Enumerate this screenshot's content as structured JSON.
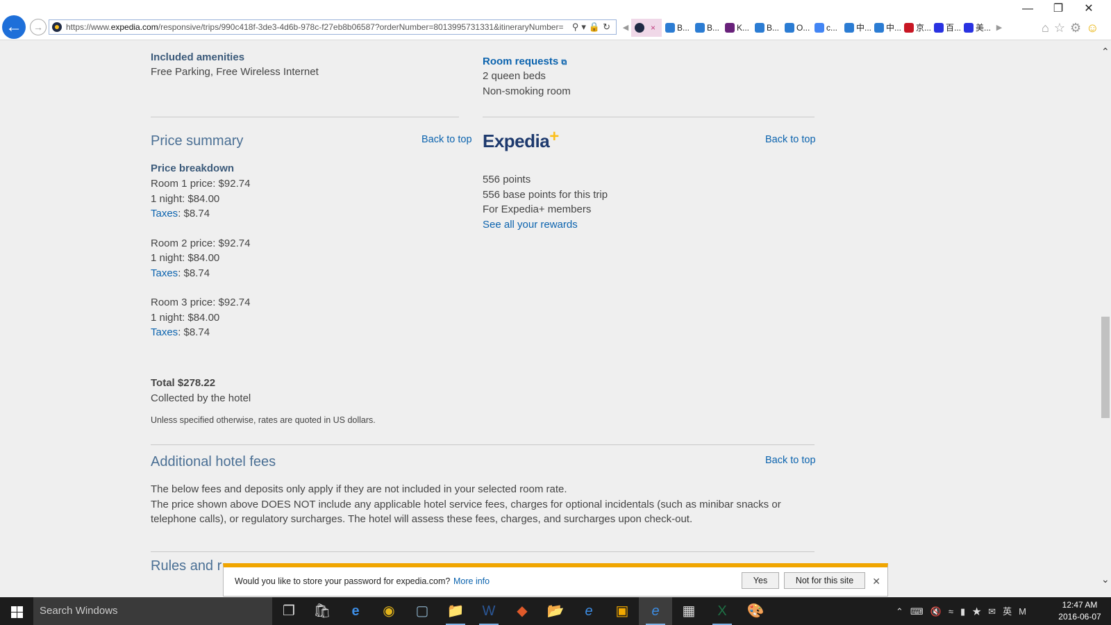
{
  "browser": {
    "url_prefix": "https://www.",
    "url_domain": "expedia.com",
    "url_rest": "/responsive/trips/990c418f-3de3-4d6b-978c-f27eb8b06587?orderNumber=8013995731331&itineraryNumber=",
    "tabs": [
      {
        "label": "B...",
        "icon": "ie-icon",
        "color": "#2b7cd3"
      },
      {
        "label": "B...",
        "icon": "ie-icon",
        "color": "#2b7cd3"
      },
      {
        "label": "K...",
        "icon": "visual-studio-icon",
        "color": "#68217a"
      },
      {
        "label": "B...",
        "icon": "ie-icon",
        "color": "#2b7cd3"
      },
      {
        "label": "O...",
        "icon": "ie-icon",
        "color": "#2b7cd3"
      },
      {
        "label": "c...",
        "icon": "google-icon",
        "color": "#4285f4"
      },
      {
        "label": "中...",
        "icon": "ie-icon",
        "color": "#2b7cd3"
      },
      {
        "label": "中...",
        "icon": "ie-icon",
        "color": "#2b7cd3"
      },
      {
        "label": "京...",
        "icon": "jd-icon",
        "color": "#c81623"
      },
      {
        "label": "百...",
        "icon": "baidu-icon",
        "color": "#2932e1"
      },
      {
        "label": "美...",
        "icon": "baidu-icon",
        "color": "#2932e1"
      }
    ]
  },
  "amenities": {
    "heading": "Included amenities",
    "text": "Free Parking, Free Wireless Internet"
  },
  "room_requests": {
    "heading": "Room requests",
    "lines": [
      "2 queen beds",
      "Non-smoking room"
    ]
  },
  "price_summary": {
    "title": "Price summary",
    "back_to_top": "Back to top",
    "breakdown_heading": "Price breakdown",
    "rooms": [
      {
        "price": "Room 1 price: $92.74",
        "night": "1 night: $84.00",
        "taxes_link": "Taxes",
        "taxes_value": ": $8.74"
      },
      {
        "price": "Room 2 price: $92.74",
        "night": "1 night: $84.00",
        "taxes_link": "Taxes",
        "taxes_value": ": $8.74"
      },
      {
        "price": "Room 3 price: $92.74",
        "night": "1 night: $84.00",
        "taxes_link": "Taxes",
        "taxes_value": ": $8.74"
      }
    ],
    "total": "Total $278.22",
    "collected": "Collected by the hotel",
    "currency_note": "Unless specified otherwise, rates are quoted in US dollars."
  },
  "expedia_plus": {
    "logo_text": "Expedia",
    "logo_plus": "+",
    "back_to_top": "Back to top",
    "points": "556 points",
    "base_points": "556 base points for this trip",
    "members": "For Expedia+ members",
    "rewards_link": "See all your rewards"
  },
  "hotel_fees": {
    "title": "Additional hotel fees",
    "back_to_top": "Back to top",
    "line1": "The below fees and deposits only apply if they are not included in your selected room rate.",
    "line2": "The price shown above DOES NOT include any applicable hotel service fees, charges for optional incidentals (such as minibar snacks or",
    "line3": "telephone calls), or regulatory surcharges. The hotel will assess these fees, charges, and surcharges upon check-out."
  },
  "rules": {
    "title_partial": "Rules and r"
  },
  "password_bar": {
    "message": "Would you like to store your password for expedia.com?",
    "more_info": "More info",
    "yes": "Yes",
    "not_for_site": "Not for this site"
  },
  "taskbar": {
    "search_placeholder": "Search Windows",
    "time": "12:47 AM",
    "date": "2016-06-07",
    "ime": "英",
    "m_label": "M"
  },
  "colors": {
    "link": "#0b63ae",
    "heading": "#4a6f94",
    "accent_bar": "#f0a500",
    "expedia_navy": "#1e3a6e",
    "expedia_yellow": "#fcbf1b"
  }
}
